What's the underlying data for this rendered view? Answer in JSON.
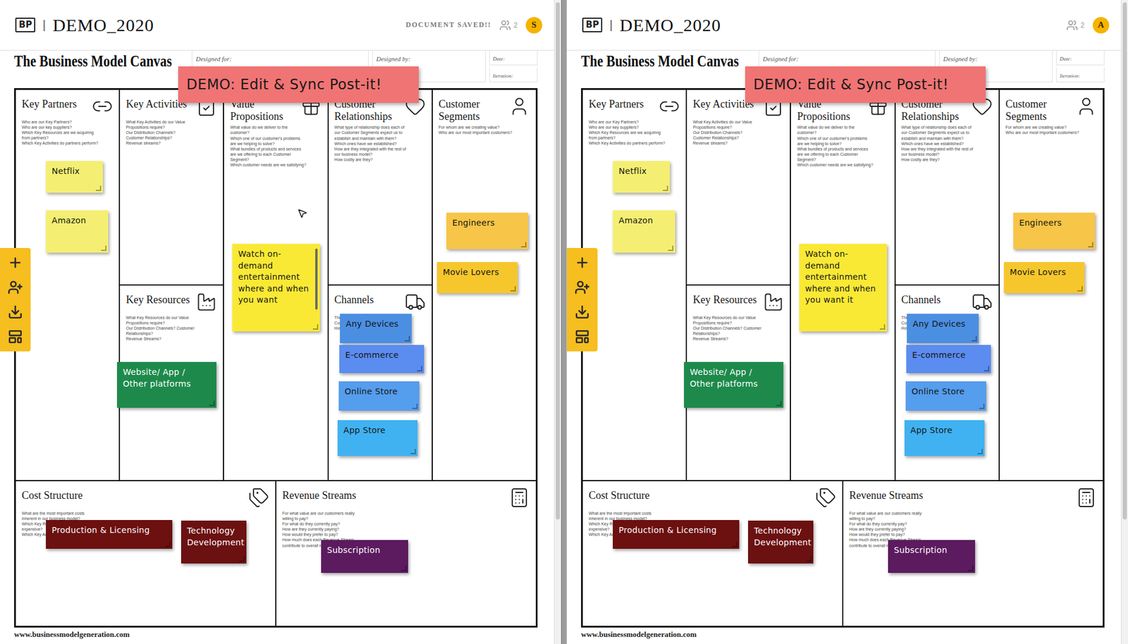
{
  "canvas_template": {
    "title": "The Business Model Canvas",
    "fields": [
      {
        "label": "Designed for:"
      },
      {
        "label": "Designed by:"
      }
    ],
    "meta": [
      {
        "label": "Date:"
      },
      {
        "label": "Iteration:"
      }
    ],
    "blocks": [
      {
        "title": "Key Partners",
        "questions": [
          "Who are our Key Partners?",
          "Who are our key suppliers?",
          "Which Key Resources are we acquiring from partners?",
          "Which Key Activities do partners perform?"
        ]
      },
      {
        "title": "Key Activities",
        "questions": [
          "What Key Activities do our Value Propositions require?",
          "Our Distribution Channels?",
          "Customer Relationships?",
          "Revenue streams?"
        ]
      },
      {
        "title": "Key Resources",
        "questions": [
          "What Key Resources do our Value Propositions require?",
          "Our Distribution Channels? Customer Relationships?",
          "Revenue Streams?"
        ]
      },
      {
        "title": "Value Propositions",
        "questions": [
          "What value do we deliver to the customer?",
          "Which one of our customer's problems are we helping to solve?",
          "What bundles of products and services are we offering to each Customer Segment?",
          "Which customer needs are we satisfying?"
        ]
      },
      {
        "title": "Customer Relationships",
        "questions": [
          "What type of relationship does each of our Customer Segments expect us to establish and maintain with them?",
          "Which ones have we established?",
          "How are they integrated with the rest of our business model?",
          "How costly are they?"
        ]
      },
      {
        "title": "Channels",
        "questions": [
          "Through which Channels do our Customer Segments want to be reached?",
          "How are we reaching them now?"
        ]
      },
      {
        "title": "Customer Segments",
        "questions": [
          "For whom are we creating value?",
          "Who are our most important customers?"
        ]
      },
      {
        "title": "Cost Structure",
        "questions": [
          "What are the most important costs inherent in our business model?",
          "Which Key Resources are most expensive?",
          "Which Key Activities are most expensive?"
        ]
      },
      {
        "title": "Revenue Streams",
        "questions": [
          "For what value are our customers really willing to pay?",
          "For what do they currently pay?",
          "How are they currently paying?",
          "How would they prefer to pay?",
          "How much does each Revenue Stream contribute to overall revenues?"
        ]
      }
    ],
    "footer": "www.businessmodelgeneration.com"
  },
  "panes": [
    {
      "header": {
        "logo": "BP",
        "separator": "|",
        "title": "DEMO_2020",
        "status": "DOCUMENT SAVED!!",
        "user_count": "2",
        "avatar": "S"
      },
      "banner": {
        "text": "DEMO: Edit & Sync Post-it!",
        "color": "#f07474"
      },
      "cursor_visible": true,
      "notes": [
        {
          "text": "Netflix",
          "color": "#f4ef72",
          "editing": false
        },
        {
          "text": "Amazon",
          "color": "#f4ef72",
          "editing": false
        },
        {
          "text": "Watch on-demand entertainment where and when you want",
          "color": "#f9e935",
          "editing": true
        },
        {
          "text": "Engineers",
          "color": "#f7c547",
          "editing": false
        },
        {
          "text": "Movie Lovers",
          "color": "#f6c72c",
          "editing": false
        },
        {
          "text": "Any Devices",
          "color": "#4b8fe2",
          "editing": false
        },
        {
          "text": "E-commerce",
          "color": "#5b8cf0",
          "editing": false
        },
        {
          "text": "Online Store",
          "color": "#559ded",
          "editing": false
        },
        {
          "text": "App Store",
          "color": "#40b2f2",
          "editing": false
        },
        {
          "text": "Website/ App / Other platforms",
          "color": "#1d8a4b",
          "editing": false
        },
        {
          "text": "Production & Licensing",
          "color": "#6c1010",
          "editing": false
        },
        {
          "text": "Technology Development",
          "color": "#6b1111",
          "editing": false
        },
        {
          "text": "Subscription",
          "color": "#5c1a5f",
          "editing": false
        }
      ]
    },
    {
      "header": {
        "logo": "BP",
        "separator": "|",
        "title": "DEMO_2020",
        "user_count": "2",
        "avatar": "A"
      },
      "banner": {
        "text": "DEMO: Edit & Sync Post-it!",
        "color": "#f07474"
      },
      "cursor_visible": false,
      "notes": [
        {
          "text": "Netflix",
          "color": "#f4ef72",
          "editing": false
        },
        {
          "text": "Amazon",
          "color": "#f4ef72",
          "editing": false
        },
        {
          "text": "Watch on-demand entertainment where and when you want it",
          "color": "#f9e935",
          "editing": false
        },
        {
          "text": "Engineers",
          "color": "#f7c547",
          "editing": false
        },
        {
          "text": "Movie Lovers",
          "color": "#f6c72c",
          "editing": false
        },
        {
          "text": "Any Devices",
          "color": "#4b8fe2",
          "editing": false
        },
        {
          "text": "E-commerce",
          "color": "#5b8cf0",
          "editing": false
        },
        {
          "text": "Online Store",
          "color": "#559ded",
          "editing": false
        },
        {
          "text": "App Store",
          "color": "#40b2f2",
          "editing": false
        },
        {
          "text": "Website/ App / Other platforms",
          "color": "#1d8a4b",
          "editing": false
        },
        {
          "text": "Production & Licensing",
          "color": "#6c1010",
          "editing": false
        },
        {
          "text": "Technology Development",
          "color": "#6b1111",
          "editing": false
        },
        {
          "text": "Subscription",
          "color": "#5c1a5f",
          "editing": false
        }
      ]
    }
  ]
}
